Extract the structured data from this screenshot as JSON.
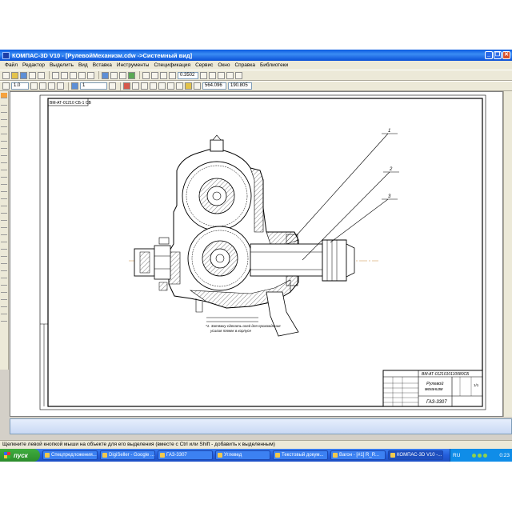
{
  "window": {
    "title": "КОМПАС-3D V10 - [РулевойМеханизм.cdw ->Системный вид]",
    "buttons": [
      "_",
      "❐",
      "✕"
    ]
  },
  "menu": {
    "items": [
      "Файл",
      "Редактор",
      "Выделить",
      "Вид",
      "Вставка",
      "Инструменты",
      "Спецификация",
      "Сервис",
      "Окно",
      "Справка",
      "Библиотеки"
    ]
  },
  "toolbar": {
    "zoom_value": "0.3502",
    "scale_value": "1.0",
    "layer_value": "1",
    "coord_x": "564.096",
    "coord_y": "190.805"
  },
  "drawing": {
    "stamp_code": "ВМ-АТ-01210 СБ-1 СВ",
    "leaders": [
      "1",
      "2",
      "3"
    ],
    "note_line1": "*1. Затяжку сделать осей для прохождения",
    "note_line2": "усилия тяжек в корпусе",
    "title_block": {
      "doc_code": "ВМ-АТ-0121010110080СБ",
      "name_line1": "Рулевой",
      "name_line2": "механизм",
      "org": "ГАЗ-3307",
      "sheet": "1/1"
    }
  },
  "status": {
    "text": "Щелкните левой кнопкой мыши на объекте для его выделения (вместе с Ctrl или Shift - добавить к выделенным)"
  },
  "taskbar": {
    "start_label": "пуск",
    "tasks": [
      "Спецпредложения...",
      "DigiSeller - Google ...",
      "ГАЗ-3307",
      "Углевед",
      "Текстовый докум...",
      "Вагон - [#1] R_R...",
      "КОМПАС-3D V10 -..."
    ],
    "lang": "RU",
    "clock": "0:23"
  }
}
